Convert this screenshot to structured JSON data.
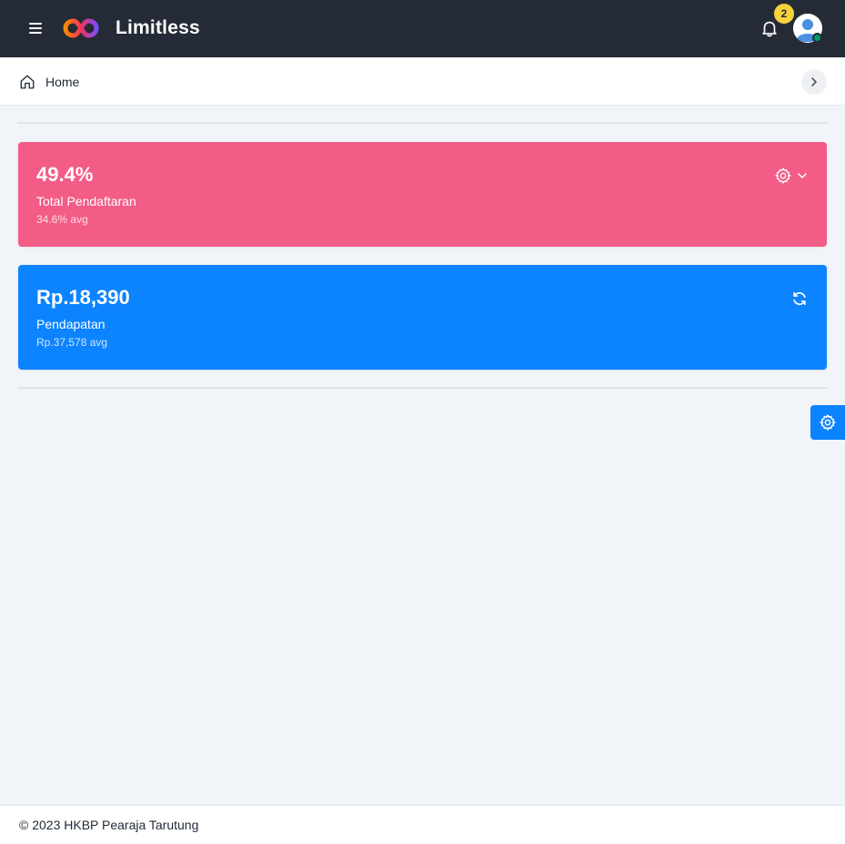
{
  "header": {
    "brand": "Limitless",
    "notification_count": "2",
    "icons": {
      "menu": "menu-icon",
      "logo": "infinity-logo",
      "bell": "bell-icon",
      "avatar": "user-avatar"
    },
    "colors": {
      "navbar": "#252b36",
      "badge": "#f8d23a",
      "online": "#059669"
    }
  },
  "breadcrumb": {
    "home_label": "Home",
    "icons": {
      "home": "home-icon",
      "next": "chevron-right-icon"
    }
  },
  "stats": [
    {
      "value": "49.4%",
      "label": "Total Pendaftaran",
      "avg": "34.6% avg",
      "color": "#f35c86",
      "icons": [
        "gear-icon",
        "chevron-down-icon"
      ]
    },
    {
      "value": "Rp.18,390",
      "label": "Pendapatan",
      "avg": "Rp.37,578 avg",
      "color": "#0c83ff",
      "icons": [
        "refresh-icon"
      ]
    }
  ],
  "side_panel": {
    "icon": "gear-icon",
    "color": "#0c83ff"
  },
  "footer": {
    "text": "© 2023 HKBP Pearaja Tarutung"
  }
}
